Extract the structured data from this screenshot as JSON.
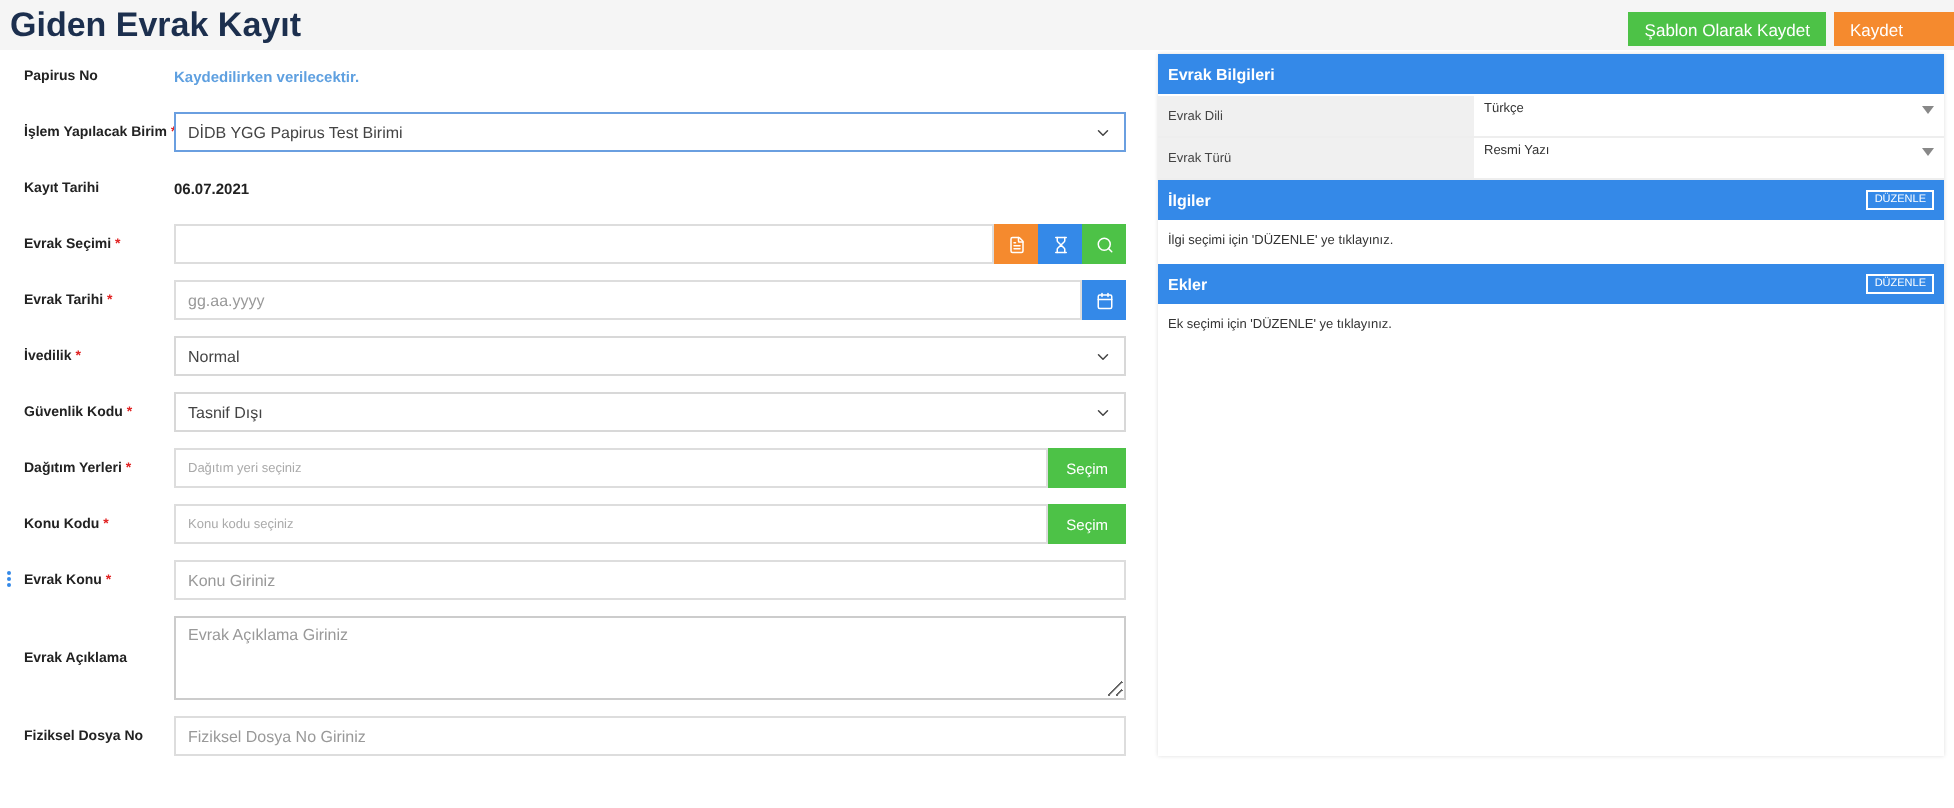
{
  "title": "Giden Evrak Kayıt",
  "actions": [
    {
      "label": "Şablon Olarak Kaydet",
      "kind": "success"
    },
    {
      "label": "Kaydet",
      "kind": "warning"
    }
  ],
  "fields": [
    {
      "kind": "note",
      "label": "Papirus No",
      "required": false,
      "value": "Kaydedilirken verilecektir."
    },
    {
      "kind": "select",
      "label": "İşlem Yapılacak Birim",
      "required": true,
      "value": "DİDB YGG Papirus Test Birimi",
      "focused": true
    },
    {
      "kind": "text",
      "label": "Kayıt Tarihi",
      "required": false,
      "value": "06.07.2021"
    },
    {
      "kind": "search",
      "label": "Evrak Seçimi",
      "required": true
    },
    {
      "kind": "date",
      "label": "Evrak Tarihi",
      "required": true,
      "placeholder": "gg.aa.yyyy"
    },
    {
      "kind": "select",
      "label": "İvedilik",
      "required": true,
      "value": "Normal",
      "focused": false
    },
    {
      "kind": "select",
      "label": "Güvenlik Kodu",
      "required": true,
      "value": "Tasnif Dışı",
      "focused": false
    },
    {
      "kind": "picker",
      "label": "Dağıtım Yerleri",
      "required": true,
      "placeholder": "Dağıtım yeri seçiniz",
      "button": "Seçim"
    },
    {
      "kind": "picker",
      "label": "Konu Kodu",
      "required": true,
      "placeholder": "Konu kodu seçiniz",
      "button": "Seçim"
    },
    {
      "kind": "input",
      "label": "Evrak Konu",
      "required": true,
      "placeholder": "Konu Giriniz"
    },
    {
      "kind": "textarea",
      "label": "Evrak Açıklama",
      "required": false,
      "placeholder": "Evrak Açıklama Giriniz"
    },
    {
      "kind": "input",
      "label": "Fiziksel Dosya No",
      "required": false,
      "placeholder": "Fiziksel Dosya No Giriniz"
    }
  ],
  "required_mark": "*",
  "info_panel": {
    "title": "Evrak Bilgileri",
    "rows": [
      {
        "label": "Evrak Dili",
        "value": "Türkçe"
      },
      {
        "label": "Evrak Türü",
        "value": "Resmi Yazı"
      }
    ]
  },
  "sections": [
    {
      "title": "İlgiler",
      "button": "DÜZENLE",
      "text": "İlgi seçimi için 'DÜZENLE' ye tıklayınız."
    },
    {
      "title": "Ekler",
      "button": "DÜZENLE",
      "text": "Ek seçimi için 'DÜZENLE' ye tıklayınız."
    }
  ]
}
